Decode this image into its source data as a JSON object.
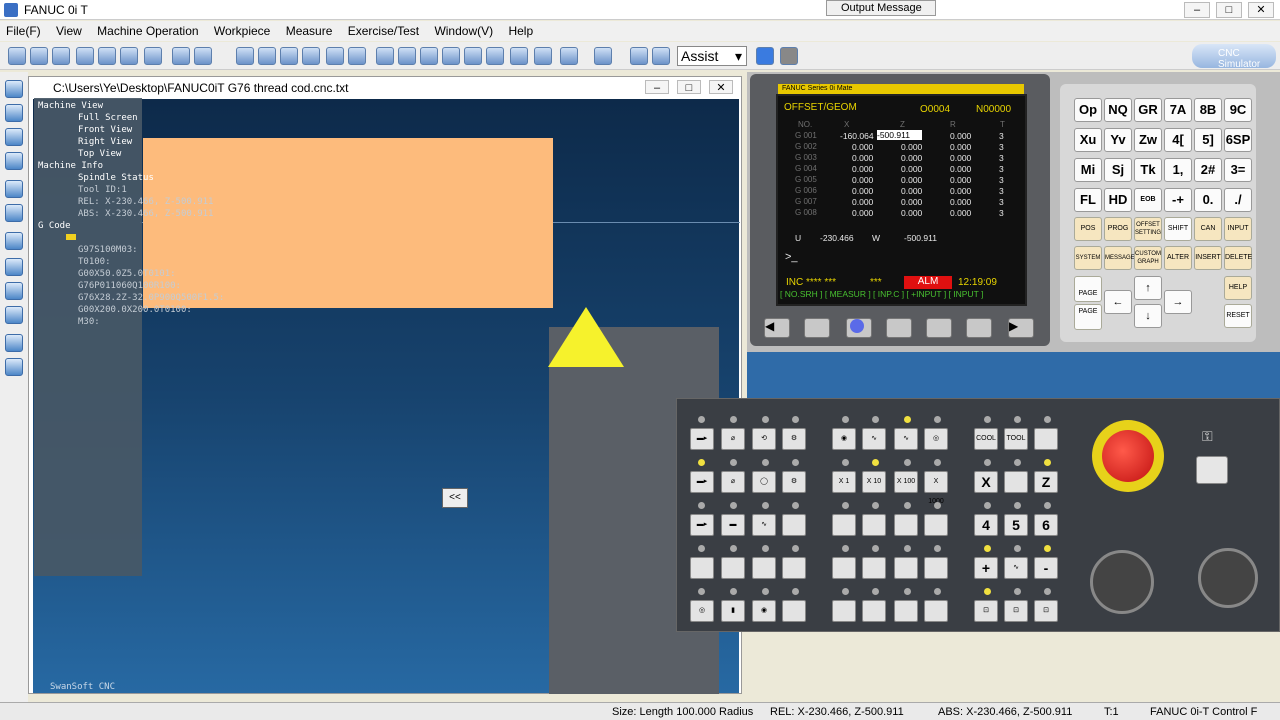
{
  "app": {
    "title": "FANUC 0i T",
    "output_message": "Output Message"
  },
  "menu": [
    "File(F)",
    "View",
    "Machine Operation",
    "Workpiece",
    "Measure",
    "Exercise/Test",
    "Window(V)",
    "Help"
  ],
  "toolbar": {
    "assist_value": "Assist",
    "logo_label": "CNC Simulator"
  },
  "view_window": {
    "title": "C:\\Users\\Ye\\Desktop\\FANUC0iT G76 thread cod.cnc.txt"
  },
  "tree": {
    "machine_view": "Machine View",
    "full_screen": "Full Screen",
    "front_view": "Front View",
    "right_view": "Right View",
    "top_view": "Top View",
    "machine_info": "Machine Info",
    "spindle_status": "Spindle Status",
    "tool_id": "Tool ID:1",
    "rel": "REL: X-230.466, Z-500.911",
    "abs": "ABS: X-230.466, Z-500.911",
    "g_code": "G Code",
    "lines": [
      "G97S100M03:",
      "T0100:",
      "G00X50.0Z5.0T0101:",
      "G76P011060Q100R100:",
      "G76X28.2Z-32.0P900Q500F1.5:",
      "G00X200.0X200.0T0100:",
      "M30:"
    ]
  },
  "viewport": {
    "watermark": "SwanSoft CNC",
    "collapse_label": "<<"
  },
  "cnc_screen": {
    "brand": "FANUC Series 0i Mate",
    "page": "OFFSET/GEOM",
    "prog_no": "O0004",
    "seq_no": "N00000",
    "headers": [
      "NO.",
      "X",
      "Z",
      "R",
      "T"
    ],
    "rows": [
      {
        "no": "G 001",
        "x": "-160.064",
        "z": "-500.911",
        "r": "0.000",
        "t": "3"
      },
      {
        "no": "G 002",
        "x": "0.000",
        "z": "0.000",
        "r": "0.000",
        "t": "3"
      },
      {
        "no": "G 003",
        "x": "0.000",
        "z": "0.000",
        "r": "0.000",
        "t": "3"
      },
      {
        "no": "G 004",
        "x": "0.000",
        "z": "0.000",
        "r": "0.000",
        "t": "3"
      },
      {
        "no": "G 005",
        "x": "0.000",
        "z": "0.000",
        "r": "0.000",
        "t": "3"
      },
      {
        "no": "G 006",
        "x": "0.000",
        "z": "0.000",
        "r": "0.000",
        "t": "3"
      },
      {
        "no": "G 007",
        "x": "0.000",
        "z": "0.000",
        "r": "0.000",
        "t": "3"
      },
      {
        "no": "G 008",
        "x": "0.000",
        "z": "0.000",
        "r": "0.000",
        "t": "3"
      }
    ],
    "u_label": "U",
    "u_value": "-230.466",
    "w_label": "W",
    "w_value": "-500.911",
    "prompt": ">_",
    "mode": "INC **** ***",
    "stars": "***",
    "alarm": "ALM",
    "time": "12:19:09",
    "softkeys": "[ NO.SRH ] [ MEASUR ] [  INP.C  ] [ +INPUT ] [  INPUT  ]"
  },
  "keypad": {
    "row1": [
      "Op",
      "NQ",
      "GR",
      "7A",
      "8B",
      "9C"
    ],
    "row2": [
      "Xu",
      "Yv",
      "Zw",
      "4[",
      "5]",
      "6SP"
    ],
    "row3": [
      "Mi",
      "Sj",
      "Tk",
      "1,",
      "2#",
      "3="
    ],
    "row4": [
      "FL",
      "HD",
      "EOB",
      "-+",
      "0.",
      "./"
    ],
    "func1": [
      "POS",
      "PROG",
      "OFFSET SETTING",
      "SHIFT",
      "CAN",
      "INPUT"
    ],
    "func2": [
      "SYSTEM",
      "MESSAGE",
      "CUSTOM GRAPH",
      "ALTER",
      "INSERT",
      "DELETE"
    ],
    "page_up": "PAGE",
    "page_down": "PAGE",
    "help": "HELP",
    "reset": "RESET"
  },
  "panel": {
    "cool": "COOL",
    "tool": "TOOL",
    "x1": "X 1",
    "x10": "X 10",
    "x100": "X 100",
    "x1000": "X 1000",
    "axis_x": "X",
    "axis_z": "Z",
    "num4": "4",
    "num5": "5",
    "num6": "6",
    "plus": "+",
    "minus": "-"
  },
  "statusbar": {
    "size": "Size: Length 100.000 Radius",
    "rel": "REL: X-230.466, Z-500.911",
    "abs": "ABS: X-230.466, Z-500.911",
    "t": "T:1",
    "control": "FANUC 0i-T Control F"
  }
}
